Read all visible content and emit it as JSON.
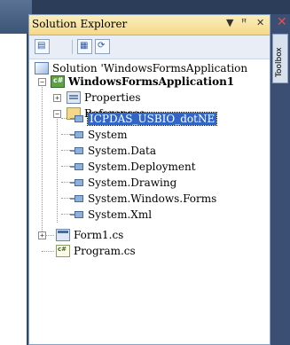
{
  "panel": {
    "title": "Solution Explorer",
    "buttons": {
      "dropdown": "▼",
      "pin": "ꟸ",
      "close": "✕"
    }
  },
  "toolbar": {
    "icons": [
      "show-all-files-icon",
      "properties-icon",
      "refresh-icon"
    ]
  },
  "tree": {
    "solution": "Solution 'WindowsFormsApplication",
    "project": "WindowsFormsApplication1",
    "properties": "Properties",
    "references": "References",
    "reference_items": [
      "ICPDAS_USBIO_dotNE",
      "System",
      "System.Data",
      "System.Deployment",
      "System.Drawing",
      "System.Windows.Forms",
      "System.Xml"
    ],
    "form1": "Form1.cs",
    "program": "Program.cs"
  },
  "toolbox": {
    "label": "Toolbox"
  }
}
